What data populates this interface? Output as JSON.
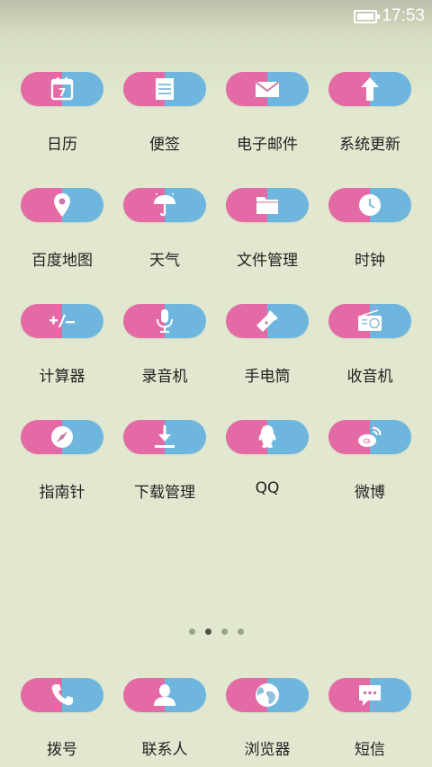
{
  "status": {
    "time": "17:53"
  },
  "apps": [
    {
      "label": "日历",
      "icon": "calendar-icon",
      "day": "7"
    },
    {
      "label": "便签",
      "icon": "notepad-icon"
    },
    {
      "label": "电子邮件",
      "icon": "mail-icon"
    },
    {
      "label": "系统更新",
      "icon": "arrow-up-icon"
    },
    {
      "label": "百度地图",
      "icon": "map-pin-icon"
    },
    {
      "label": "天气",
      "icon": "umbrella-icon"
    },
    {
      "label": "文件管理",
      "icon": "folder-icon"
    },
    {
      "label": "时钟",
      "icon": "clock-icon"
    },
    {
      "label": "计算器",
      "icon": "calculator-icon"
    },
    {
      "label": "录音机",
      "icon": "microphone-icon"
    },
    {
      "label": "手电筒",
      "icon": "flashlight-icon"
    },
    {
      "label": "收音机",
      "icon": "radio-icon"
    },
    {
      "label": "指南针",
      "icon": "compass-icon"
    },
    {
      "label": "下载管理",
      "icon": "download-icon"
    },
    {
      "label": "QQ",
      "icon": "qq-penguin-icon"
    },
    {
      "label": "微博",
      "icon": "weibo-icon"
    }
  ],
  "pager": {
    "count": 4,
    "active": 1
  },
  "dock": [
    {
      "label": "拨号",
      "icon": "phone-icon"
    },
    {
      "label": "联系人",
      "icon": "contact-icon"
    },
    {
      "label": "浏览器",
      "icon": "globe-icon"
    },
    {
      "label": "短信",
      "icon": "message-icon"
    }
  ],
  "colors": {
    "pill_left": "#e36aa4",
    "pill_right": "#6fb6df",
    "background": "#e1e8cf"
  }
}
